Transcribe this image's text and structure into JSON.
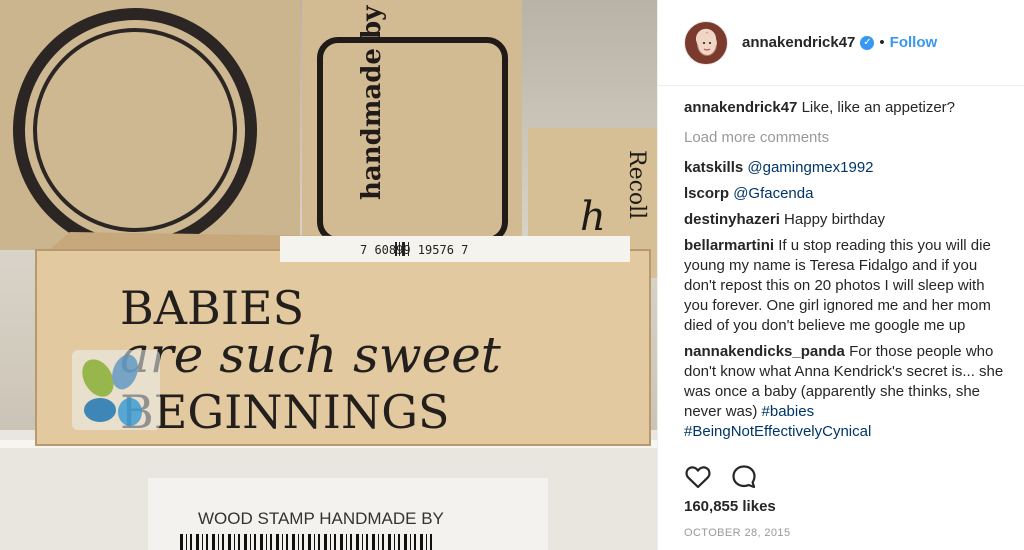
{
  "post": {
    "username": "annakendrick47",
    "verified_glyph": "✓",
    "separator": "•",
    "follow_label": "Follow",
    "load_more_label": "Load more comments",
    "likes": "160,855 likes",
    "date": "OCTOBER 28, 2015",
    "caption": {
      "user": "annakendrick47",
      "text": "Like, like an appetizer?"
    }
  },
  "comments": [
    {
      "user": "katskills",
      "text": "@gamingmex1992",
      "mention": true
    },
    {
      "user": "lscorp",
      "text": "@Gfacenda",
      "mention": true
    },
    {
      "user": "destinyhazeri",
      "text": "Happy birthday",
      "mention": false
    },
    {
      "user": "bellarmartini",
      "text": "If u stop reading this you will die young my name is Teresa Fidalgo and if you don't repost this on 20 photos I will sleep with you forever. One girl ignored me and her mom died of you don't believe me google me up",
      "mention": false
    },
    {
      "user": "nannakendicks_panda",
      "text": "For those people who don't know what Anna Kendrick's secret is... she was once a baby (apparently she thinks, she never was)",
      "mention": false,
      "hashtags": "#babies #BeingNotEffectivelyCynical"
    }
  ],
  "photo": {
    "stamp_line1": "BABIES",
    "stamp_line2": "are such sweet",
    "stamp_line3": "BEGINNINGS",
    "barcode_number": "7 60899 19576 7",
    "side_stamp_text": "handmade by",
    "label_text": "WOOD STAMP HANDMADE BY",
    "back_stamp_text": "Recoll"
  },
  "icons": {
    "like": "heart-icon",
    "comment": "comment-icon"
  },
  "colors": {
    "link": "#3897f0",
    "mention": "#003569",
    "muted": "#999999"
  }
}
